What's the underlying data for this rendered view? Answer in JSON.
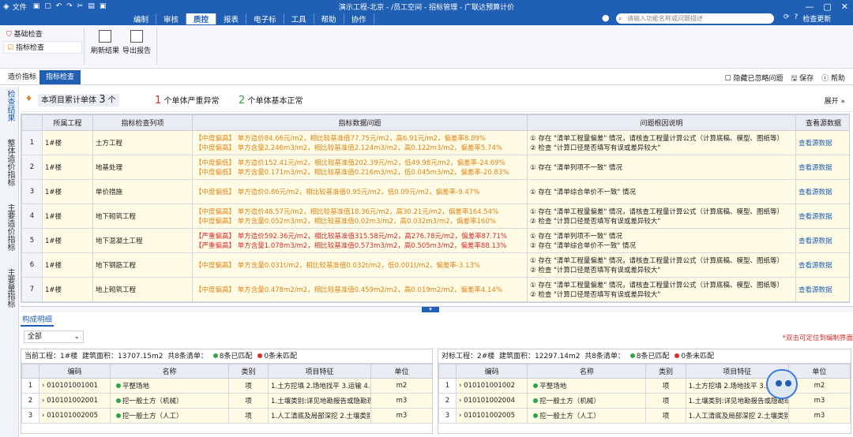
{
  "title": "演示工程-北京 - /员工空间 - 招标管理 - 广联达预算计价",
  "menu": [
    "文件",
    "编制",
    "审核",
    "质控",
    "报表",
    "电子标",
    "工具",
    "帮助",
    "协作"
  ],
  "menu_active": "质控",
  "search_placeholder": "请输入功能名称或问题描述",
  "check_update": "检查更新",
  "left_checks": [
    "基础检查",
    "指标检查"
  ],
  "ribbon_buttons": [
    "刷新结果",
    "导出报告"
  ],
  "tabs": [
    "造价指标",
    "指标检查"
  ],
  "tab_right": {
    "hide": "隐藏已忽略问题",
    "save": "保存",
    "help": "帮助"
  },
  "sidebar": [
    "检查结果",
    "整体造价指标",
    "主要造价指标",
    "主要量指标"
  ],
  "summary": {
    "s1_label": "本项目累计单体",
    "s1_count": "3",
    "s1_unit": "个",
    "s2_count": "1",
    "s2_label": "个单体严重异常",
    "s3_count": "2",
    "s3_label": "个单体基本正常",
    "expand": "展开"
  },
  "grid_headers": [
    "",
    "所属工程",
    "指标检查列项",
    "指标数据问题",
    "问题根因说明",
    "查看源数据"
  ],
  "grid_rows": [
    {
      "n": "1",
      "proj": "1#楼",
      "item": "土方工程",
      "d1": "【中度偏高】 单方造价84.66元/m2，相比较基准值77.75元/m2，高6.91元/m2，偏差率8.89%",
      "d2": "【中度偏高】 单方含量2.246m3/m2，相比较基准值2.124m3/m2，高0.122m3/m2，偏差率5.74%",
      "r1": "① 存在 \"清单工程量偏差\" 情况，请核查工程量计算公式（计算底稿、模型、图纸等）",
      "r2": "② 检查 \"计算口径是否填写有误或差异较大\"",
      "src": "查看源数据"
    },
    {
      "n": "2",
      "proj": "1#楼",
      "item": "地基处理",
      "d1": "【中度偏低】 单方造价152.41元/m2，相比较基准值202.39元/m2，低49.98元/m2，偏差率-24.69%",
      "d2": "【中度偏低】 单方含量0.171m3/m2，相比较基准值0.216m3/m2，低0.045m3/m2，偏差率-20.83%",
      "r1": "① 存在 \"清单列项不一致\" 情况",
      "r2": "",
      "src": "查看源数据"
    },
    {
      "n": "3",
      "proj": "1#楼",
      "item": "单价措施",
      "d1": "【中度偏低】 单方造价0.86元/m2，相比较基准值0.95元/m2，低0.09元/m2，偏差率-9.47%",
      "d2": "",
      "r1": "① 存在 \"清单综合单价不一致\" 情况",
      "r2": "",
      "src": "查看源数据"
    },
    {
      "n": "4",
      "proj": "1#楼",
      "item": "地下砌筑工程",
      "d1": "【中度偏高】 单方造价48.57元/m2，相比较基准值18.36元/m2，高30.21元/m2，偏差率164.54%",
      "d2": "【中度偏高】 单方含量0.052m3/m2，相比较基准值0.02m3/m2，高0.032m3/m2，偏差率160%",
      "r1": "① 存在 \"清单工程量偏差\" 情况，请核查工程量计算公式（计算底稿、模型、图纸等）",
      "r2": "② 检查 \"计算口径是否填写有误或差异较大\"",
      "src": "查看源数据"
    },
    {
      "n": "5",
      "proj": "1#楼",
      "item": "地下混凝土工程",
      "d1": "【严重偏高】 单方造价592.36元/m2，相比较基准值315.58元/m2，高276.78元/m2，偏差率87.71%",
      "d2": "【严重偏高】 单方含量1.078m3/m2，相比较基准值0.573m3/m2，高0.505m3/m2，偏差率88.13%",
      "r1": "① 存在 \"清单列项不一致\" 情况",
      "r2": "② 存在 \"清单综合单价不一致\" 情况",
      "src": "查看源数据"
    },
    {
      "n": "6",
      "proj": "1#楼",
      "item": "地下钢筋工程",
      "d1": "【中度偏高】 单方含量0.031t/m2，相比较基准值0.032t/m2，低0.001t/m2，偏差率-3.13%",
      "d2": "",
      "r1": "① 存在 \"清单工程量偏差\" 情况，请核查工程量计算公式（计算底稿、模型、图纸等）",
      "r2": "② 检查 \"计算口径是否填写有误或差异较大\"",
      "src": "查看源数据"
    },
    {
      "n": "7",
      "proj": "1#楼",
      "item": "地上砌筑工程",
      "d1": "【中度偏高】 单方含量0.478m2/m2，相比较基准值0.459m2/m2，高0.019m2/m2，偏差率4.14%",
      "d2": "",
      "r1": "① 存在 \"清单工程量偏差\" 情况，请核查工程量计算公式（计算底稿、模型、图纸等）",
      "r2": "② 检查 \"计算口径是否填写有误或差异较大\"",
      "src": "查看源数据"
    }
  ],
  "bottom": {
    "title": "构成明细",
    "filter": "全部",
    "tip": "*双击可定位到编制界面",
    "left_header": {
      "label": "当前工程：1#楼",
      "area": "建筑面积：13707.15m2",
      "count": "共8条清单：",
      "matched": "8条已匹配",
      "unmatched": "0条未匹配"
    },
    "right_header": {
      "label": "对标工程：2#楼",
      "area": "建筑面积：12297.14m2",
      "count": "共8条清单：",
      "matched": "8条已匹配",
      "unmatched": "0条未匹配"
    },
    "cols": [
      "",
      "编码",
      "名称",
      "类别",
      "项目特征",
      "单位"
    ],
    "left_rows": [
      [
        "1",
        "010101001001",
        "平整场地",
        "项",
        "1.土方挖填 2.场地找平 3.运输 4....",
        "m2"
      ],
      [
        "2",
        "010101002001",
        "挖一般土方（机械）",
        "项",
        "1.土壤类别:详见地勘报告或隐勘现...",
        "m3"
      ],
      [
        "3",
        "010101002005",
        "挖一般土方（人工）",
        "项",
        "1.人工清底及局部深挖 2.土壤类别...",
        "m3"
      ]
    ],
    "right_rows": [
      [
        "1",
        "010101001002",
        "平整场地",
        "项",
        "1.土方挖填 2.场地找平 3.运输 4....",
        "m2"
      ],
      [
        "2",
        "010101002004",
        "挖一般土方（机械）",
        "项",
        "1.土壤类别:详见地勘报告或隐勘现...",
        "m3"
      ],
      [
        "3",
        "010101002005",
        "挖一般土方（人工）",
        "项",
        "1.人工清底及局部深挖 2.土壤类别...",
        "m3"
      ]
    ]
  },
  "colors": {
    "primary": "#1f5fb4",
    "warn": "#e0851a",
    "severe": "#d92c2c",
    "matched": "#2aa84a",
    "unmatched": "#d92c2c"
  }
}
